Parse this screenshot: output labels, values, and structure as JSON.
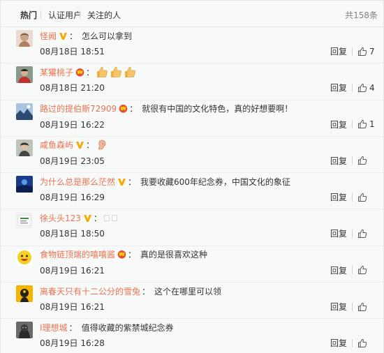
{
  "tabs": [
    {
      "label": "热门"
    },
    {
      "label": "认证用户"
    },
    {
      "label": "关注的人"
    }
  ],
  "total_label": "共158条",
  "comments": [
    {
      "user": "怪阙",
      "badge": "v-yellow",
      "colon": "：",
      "text": "怎么可以拿到",
      "time": "08月18日 18:51",
      "reply": "回复",
      "likes": "7",
      "emojis": []
    },
    {
      "user": "某獾桃子",
      "badge": "vip-red",
      "colon": "：",
      "text": "",
      "time": "08月18日 21:20",
      "reply": "回复",
      "likes": "4",
      "emojis": [
        "thumbs-up-emoji",
        "thumbs-up-emoji",
        "thumbs-up-emoji"
      ]
    },
    {
      "user": "路过的提伯斯72909",
      "badge": "vip-red",
      "colon": "：",
      "text": "就很有中国的文化特色，真的好想要啊！",
      "time": "08月19日 16:22",
      "reply": "回复",
      "likes": "1",
      "emojis": []
    },
    {
      "user": "咸鱼森屿",
      "badge": "v-yellow",
      "colon": "：",
      "text": "",
      "time": "08月19日 23:05",
      "reply": "回复",
      "likes": "",
      "emojis": [
        "ear-emoji"
      ]
    },
    {
      "user": "为什么总是那么茫然",
      "badge": "v-yellow",
      "colon": "：",
      "text": "我要收藏600年纪念券，中国文化的象征",
      "time": "08月19日 16:29",
      "reply": "回复",
      "likes": "",
      "emojis": []
    },
    {
      "user": "徐头头123",
      "badge": "v-yellow",
      "colon": "：",
      "text": "",
      "time": "08月18日 18:50",
      "reply": "回复",
      "likes": "",
      "emojis": [
        "placeholder",
        "placeholder"
      ]
    },
    {
      "user": "食物链顶端的嘻嘻酱",
      "badge": "vip-red",
      "colon": "：",
      "text": "真的是很喜欢这种",
      "time": "08月19日 16:21",
      "reply": "回复",
      "likes": "",
      "emojis": []
    },
    {
      "user": "离春天只有十二公分的雪兔",
      "badge": "",
      "colon": "：",
      "text": "这个在哪里可以领",
      "time": "08月19日 16:21",
      "reply": "回复",
      "likes": "",
      "emojis": []
    },
    {
      "user": "I理想城",
      "badge": "",
      "colon": "：",
      "text": "值得收藏的紫禁城纪念券",
      "time": "08月19日 16:28",
      "reply": "回复",
      "likes": "",
      "emojis": []
    }
  ],
  "colors": {
    "username": "#eb7350",
    "background": "#f8f9f9",
    "border": "#e6e6e6",
    "vip_badge": "#f7a800",
    "vip_red": "#e94a3b"
  }
}
